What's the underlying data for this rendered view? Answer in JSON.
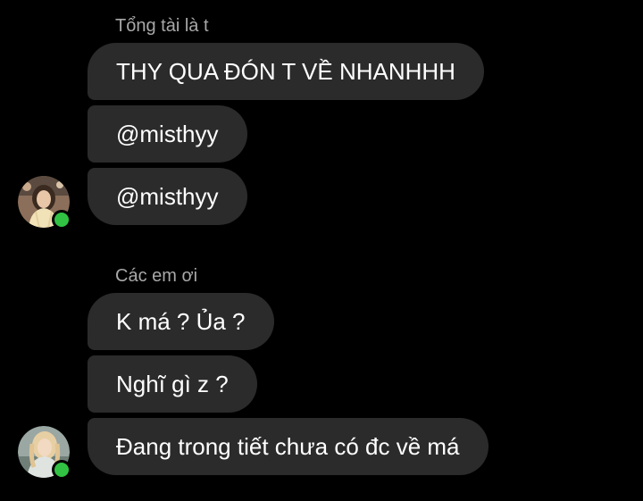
{
  "groups": [
    {
      "sender": "Tổng tài là t",
      "messages": [
        "THY QUA ĐÓN T VỀ NHANHHH",
        "@misthyy",
        "@misthyy"
      ]
    },
    {
      "sender": "Các em ơi",
      "messages": [
        "K má ? Ủa ?",
        "Nghĩ gì z ?",
        "Đang trong tiết chưa có đc về má"
      ]
    }
  ],
  "colors": {
    "background": "#000000",
    "bubble": "#2b2b2b",
    "sender_name": "#a8a8a8",
    "message_text": "#ffffff",
    "online_indicator": "#31c244"
  }
}
